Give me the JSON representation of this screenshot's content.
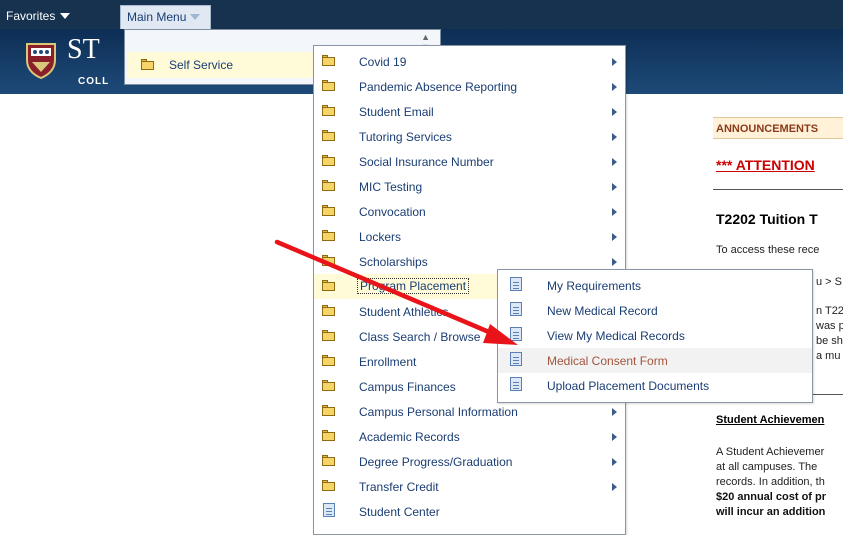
{
  "topnav": {
    "favorites_label": "Favorites",
    "main_menu_label": "Main Menu"
  },
  "brand": {
    "title": "ST",
    "subtitle": "COLL"
  },
  "menu1": {
    "items": [
      {
        "label": "Self Service"
      }
    ]
  },
  "menu2": {
    "items": [
      {
        "label": "Covid 19",
        "submenu": true
      },
      {
        "label": "Pandemic Absence Reporting",
        "submenu": true
      },
      {
        "label": "Student Email",
        "submenu": true
      },
      {
        "label": "Tutoring Services",
        "submenu": true
      },
      {
        "label": "Social Insurance Number",
        "submenu": true
      },
      {
        "label": "MIC Testing",
        "submenu": true
      },
      {
        "label": "Convocation",
        "submenu": true
      },
      {
        "label": "Lockers",
        "submenu": true
      },
      {
        "label": "Scholarships",
        "submenu": true
      },
      {
        "label": "Program Placement",
        "submenu": false
      },
      {
        "label": "Student Athletics",
        "submenu": false
      },
      {
        "label": "Class Search / Browse",
        "submenu": false
      },
      {
        "label": "Enrollment",
        "submenu": false
      },
      {
        "label": "Campus Finances",
        "submenu": false
      },
      {
        "label": "Campus Personal Information",
        "submenu": true
      },
      {
        "label": "Academic Records",
        "submenu": true
      },
      {
        "label": "Degree Progress/Graduation",
        "submenu": true
      },
      {
        "label": "Transfer Credit",
        "submenu": true
      },
      {
        "label": "Student Center",
        "submenu": false
      }
    ]
  },
  "menu3": {
    "items": [
      {
        "label": "My Requirements"
      },
      {
        "label": "New Medical Record"
      },
      {
        "label": "View My Medical Records"
      },
      {
        "label": "Medical Consent Form"
      },
      {
        "label": "Upload Placement Documents"
      }
    ]
  },
  "content": {
    "announcements_heading": "ANNOUNCEMENTS",
    "attention": "*** ATTENTION",
    "t2202_heading": "T2202 Tuition T",
    "lines": [
      "To access these rece",
      "u > S",
      "n T22",
      "was p",
      "be sh",
      "a mu"
    ],
    "student_achievement_heading": "Student Achievemen",
    "sa_lines": [
      "A Student Achievemer",
      "at all campuses. The",
      "records. In addition, th",
      "$20 annual cost of pr",
      "will incur an addition"
    ]
  },
  "colors": {
    "accent_arrow": "#e8141a",
    "highlight_row": "#fffbd8",
    "link_text": "#1a3d73"
  }
}
